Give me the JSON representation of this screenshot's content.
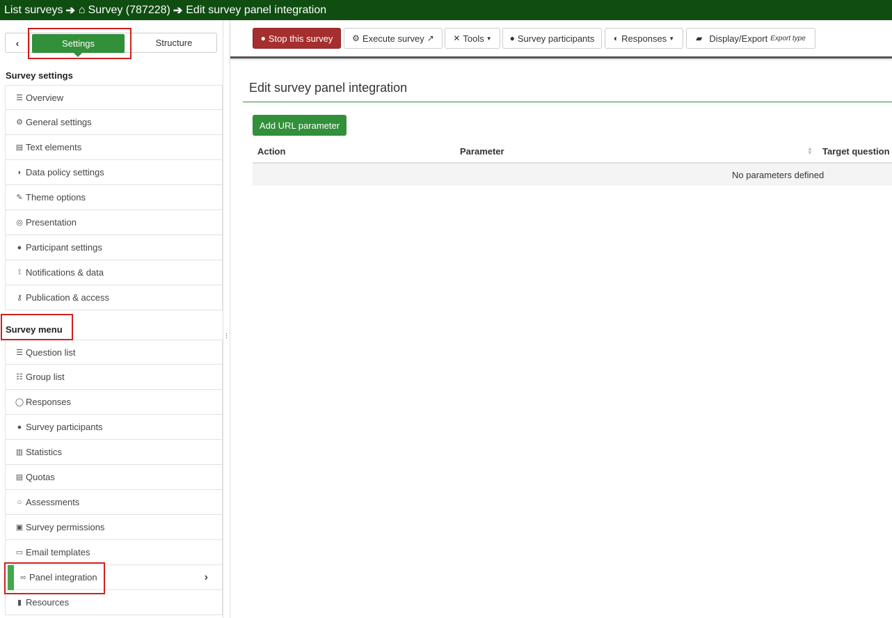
{
  "breadcrumb": {
    "list_surveys": "List surveys",
    "survey": "Survey (787228)",
    "current": "Edit survey panel integration"
  },
  "sidebar": {
    "tabs": {
      "settings": "Settings",
      "structure": "Structure"
    },
    "survey_settings_title": "Survey settings",
    "settings_items": [
      {
        "label": "Overview",
        "icon": "list-icon"
      },
      {
        "label": "General settings",
        "icon": "gears-icon"
      },
      {
        "label": "Text elements",
        "icon": "file-text-icon"
      },
      {
        "label": "Data policy settings",
        "icon": "shield-icon"
      },
      {
        "label": "Theme options",
        "icon": "paint-brush-icon"
      },
      {
        "label": "Presentation",
        "icon": "eye-slash-icon"
      },
      {
        "label": "Participant settings",
        "icon": "users-icon"
      },
      {
        "label": "Notifications & data",
        "icon": "feed-icon"
      },
      {
        "label": "Publication & access",
        "icon": "key-icon"
      }
    ],
    "survey_menu_title": "Survey menu",
    "menu_items": [
      {
        "label": "Question list",
        "icon": "list-icon"
      },
      {
        "label": "Group list",
        "icon": "th-list-icon"
      },
      {
        "label": "Responses",
        "icon": "comment-icon"
      },
      {
        "label": "Survey participants",
        "icon": "user-icon"
      },
      {
        "label": "Statistics",
        "icon": "bar-chart-icon"
      },
      {
        "label": "Quotas",
        "icon": "tasks-icon"
      },
      {
        "label": "Assessments",
        "icon": "comment-o-icon"
      },
      {
        "label": "Survey permissions",
        "icon": "lock-icon"
      },
      {
        "label": "Email templates",
        "icon": "envelope-icon"
      },
      {
        "label": "Panel integration",
        "icon": "link-icon",
        "active": true
      },
      {
        "label": "Resources",
        "icon": "file-icon"
      }
    ]
  },
  "toolbar": {
    "stop_survey": "Stop this survey",
    "execute_survey": "Execute survey",
    "tools": "Tools",
    "survey_participants": "Survey participants",
    "responses": "Responses",
    "display_export": "Display/Export",
    "export_type": "Export type"
  },
  "main": {
    "title": "Edit survey panel integration",
    "add_button": "Add URL parameter",
    "columns": [
      "Action",
      "Parameter",
      "Target question"
    ],
    "empty_message": "No parameters defined"
  },
  "colors": {
    "topbar": "#0f4d11",
    "primary_green": "#328f3a",
    "danger_red": "#a52e2e",
    "highlight_red": "#d01f1f"
  }
}
